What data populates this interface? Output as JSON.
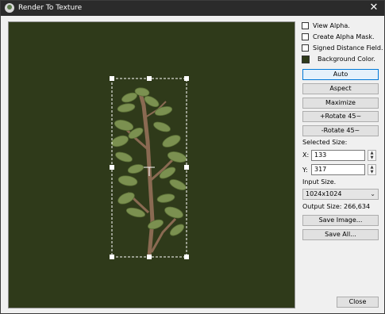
{
  "window": {
    "title": "Render To Texture",
    "close_glyph": "✕"
  },
  "options": {
    "view_alpha": "View Alpha.",
    "create_alpha_mask": "Create Alpha Mask.",
    "signed_distance_field": "Signed Distance Field.",
    "background_color": "Background Color.",
    "background_color_value": "#2f3a1a"
  },
  "buttons": {
    "auto": "Auto",
    "aspect": "Aspect",
    "maximize": "Maximize",
    "rotate_plus": "+Rotate 45~",
    "rotate_minus": "-Rotate 45~",
    "save_image": "Save Image...",
    "save_all": "Save All...",
    "close": "Close"
  },
  "selected_size": {
    "label": "Selected Size:",
    "x_label": "X:",
    "x_value": "133",
    "y_label": "Y:",
    "y_value": "317"
  },
  "input_size": {
    "label": "Input Size.",
    "selected": "1024x1024"
  },
  "output_size": "Output Size: 266,634",
  "icons": {
    "app": "app-icon",
    "close": "close-icon",
    "spin_up": "▲",
    "spin_down": "▼",
    "chevron": "⌄"
  }
}
